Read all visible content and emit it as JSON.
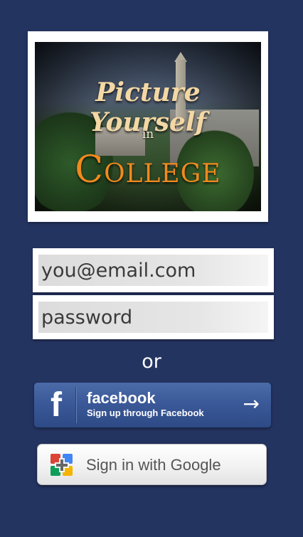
{
  "logo": {
    "line1": "Picture Yourself",
    "line2": "in",
    "line3": "College"
  },
  "form": {
    "email_placeholder": "you@email.com",
    "password_placeholder": "password",
    "or_label": "or"
  },
  "facebook_button": {
    "icon": "facebook-f-icon",
    "title": "facebook",
    "subtitle": "Sign up through Facebook",
    "arrow": "→"
  },
  "google_button": {
    "icon": "google-plus-icon",
    "label": "Sign in with Google"
  },
  "colors": {
    "background": "#243461",
    "facebook": "#3b5998",
    "logo_accent": "#f08a1e"
  }
}
